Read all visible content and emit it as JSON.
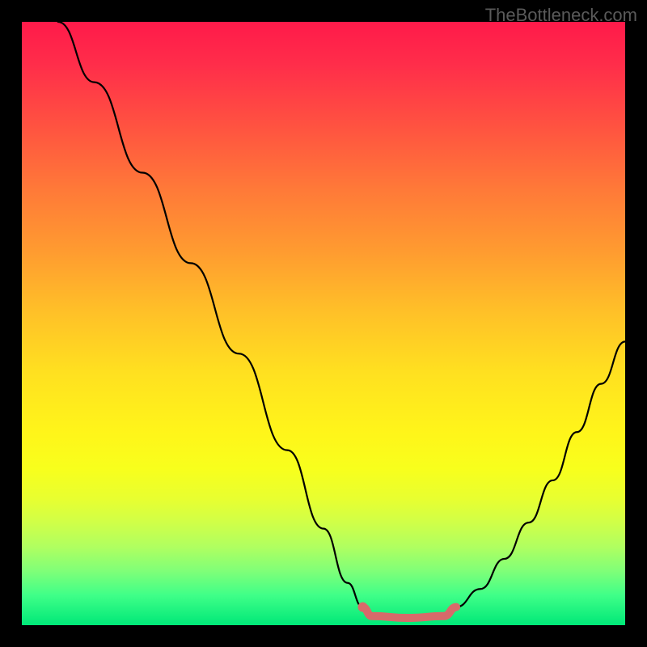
{
  "watermark": "TheBottleneck.com",
  "chart_data": {
    "type": "line",
    "title": "",
    "xlabel": "",
    "ylabel": "",
    "xlim": [
      0,
      100
    ],
    "ylim": [
      0,
      100
    ],
    "grid": false,
    "series": [
      {
        "name": "left-curve",
        "color": "#000000",
        "x": [
          6,
          12,
          20,
          28,
          36,
          44,
          50,
          54,
          56.5
        ],
        "y": [
          100,
          90,
          75,
          60,
          45,
          29,
          16,
          7,
          3
        ]
      },
      {
        "name": "right-curve",
        "color": "#000000",
        "x": [
          72,
          76,
          80,
          84,
          88,
          92,
          96,
          100
        ],
        "y": [
          3,
          6,
          11,
          17,
          24,
          32,
          40,
          47
        ]
      },
      {
        "name": "flat-highlight",
        "color": "#d86a6a",
        "x": [
          56.5,
          58,
          64,
          70,
          72
        ],
        "y": [
          3,
          1.5,
          1.2,
          1.5,
          3
        ]
      }
    ],
    "markers": [
      {
        "name": "left-dot",
        "x": 56.5,
        "y": 3,
        "color": "#d86a6a",
        "size": 6
      }
    ],
    "gradient_stops": [
      {
        "pos": 0,
        "color": "#ff1a4a"
      },
      {
        "pos": 50,
        "color": "#ffe020"
      },
      {
        "pos": 100,
        "color": "#00e878"
      }
    ]
  }
}
